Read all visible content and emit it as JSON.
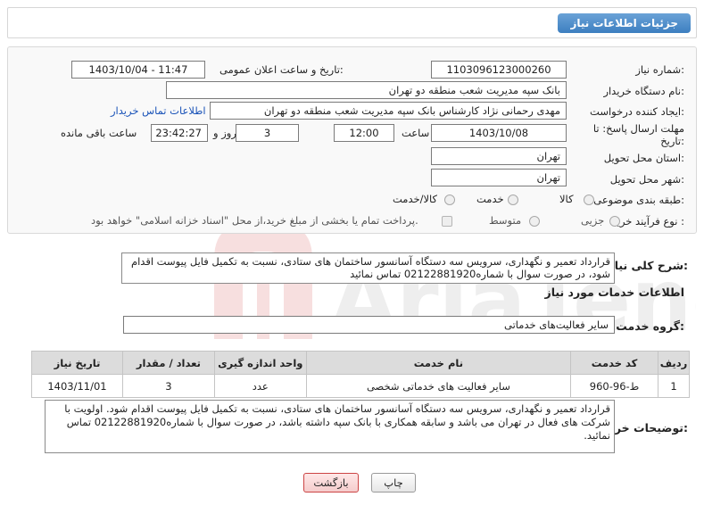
{
  "header": {
    "title": "جزئیات اطلاعات نیاز"
  },
  "form": {
    "need_number_label": "شماره نیاز:",
    "need_number": "1103096123000260",
    "announce_label": "تاریخ و ساعت اعلان عمومی:",
    "announce_value": "1403/10/04 - 11:47",
    "buyer_org_label": "نام دستگاه خریدار:",
    "buyer_org": "بانک سپه مدیریت شعب منطقه دو تهران",
    "creator_label": "ایجاد کننده درخواست:",
    "creator": "مهدی رحمانی نژاد کارشناس بانک سپه مدیریت شعب منطقه دو تهران",
    "contact_link": "اطلاعات تماس خریدار",
    "deadline_label_1": "مهلت ارسال پاسخ: تا",
    "deadline_label_2": "تاریخ:",
    "deadline_date": "1403/10/08",
    "time_label": "ساعت",
    "deadline_time": "12:00",
    "days_value": "3",
    "days_label": "روز و",
    "remaining_time": "23:42:27",
    "remaining_label": "ساعت باقی مانده",
    "province_label": "استان محل تحویل:",
    "province": "تهران",
    "city_label": "شهر محل تحویل:",
    "city": "تهران",
    "category_label": "طبقه بندی موضوعی:",
    "category_options": [
      "کالا",
      "خدمت",
      "کالا/خدمت"
    ],
    "process_label": "نوع فرآیند خرید :",
    "process_options": [
      "جزیی",
      "متوسط"
    ],
    "payment_note": "پرداخت تمام یا بخشی از مبلغ خرید،از محل \"اسناد خزانه اسلامی\" خواهد بود."
  },
  "summary": {
    "label": "شرح کلی نیاز:",
    "text": "قرارداد تعمیر و نگهداری، سرویس سه دستگاه آسانسور ساختمان های ستادی، نسبت به تکمیل فایل پیوست اقدام شود، در صورت سوال با شماره02122881920 تماس نمائید"
  },
  "services": {
    "section_title": "اطلاعات خدمات مورد نیاز",
    "group_label": "گروه خدمت:",
    "group_value": "سایر فعالیت‌های خدماتی",
    "columns": [
      "ردیف",
      "کد خدمت",
      "نام خدمت",
      "واحد اندازه گیری",
      "تعداد / مقدار",
      "تاریخ نیاز"
    ],
    "rows": [
      {
        "row": "1",
        "code": "ط-96-960",
        "name": "سایر فعالیت های خدماتی شخصی",
        "unit": "عدد",
        "qty": "3",
        "date": "1403/11/01"
      }
    ]
  },
  "buyer_notes": {
    "label": "توضیحات خریدار:",
    "text": "قرارداد تعمیر و نگهداری، سرویس سه دستگاه آسانسور ساختمان های ستادی، نسبت به تکمیل فایل پیوست اقدام شود. اولویت با شرکت های فعال در تهران می باشد و سابقه همکاری با بانک سپه داشته باشد، در صورت سوال با شماره02122881920 تماس نمائید."
  },
  "buttons": {
    "print": "چاپ",
    "back": "بازگشت"
  },
  "colors": {
    "header_blue": "#3d7fc0",
    "link_blue": "#1a53b8",
    "back_red": "#c44444"
  }
}
